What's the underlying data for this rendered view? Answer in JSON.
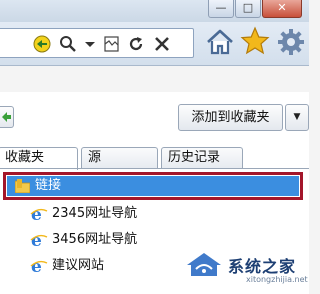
{
  "window_controls": {
    "minimize_glyph": "—",
    "maximize_glyph": "□",
    "close_glyph": "✕"
  },
  "toolbar": {
    "icons": [
      "compatibility-icon",
      "search-icon",
      "dropdown-arrow-icon",
      "compat-view-icon",
      "refresh-icon",
      "stop-icon",
      "home-icon",
      "favorites-star-icon",
      "tools-gear-icon"
    ]
  },
  "favorites_center": {
    "add_button_label": "添加到收藏夹",
    "add_dropdown_glyph": "▼",
    "tabs": [
      {
        "label": "收藏夹",
        "active": true
      },
      {
        "label": "源",
        "active": false
      },
      {
        "label": "历史记录",
        "active": false
      }
    ],
    "selected_folder": {
      "label": "链接"
    },
    "items": [
      {
        "label": "2345网址导航"
      },
      {
        "label": "3456网址导航"
      },
      {
        "label": "建议网站"
      }
    ]
  },
  "watermark": {
    "text": "系统之家",
    "url": "xitongzhijia.net"
  },
  "colors": {
    "selection": "#3b8ee0",
    "highlight_border": "#a3162a",
    "star": "#f2b81b"
  }
}
